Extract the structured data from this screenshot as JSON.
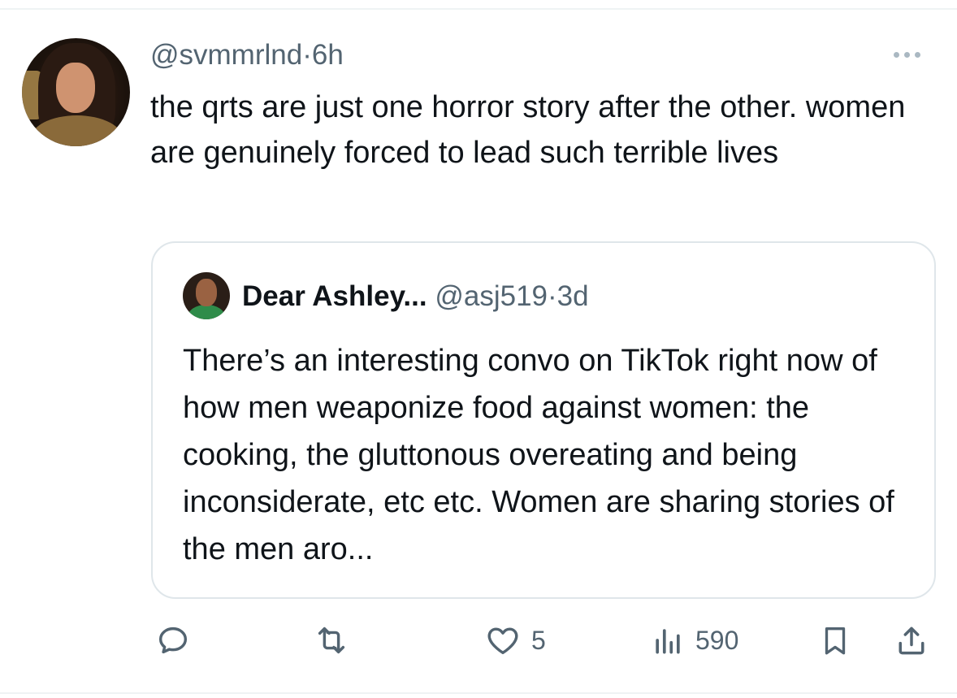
{
  "tweet": {
    "handle": "@svmmrlnd",
    "separator": "·",
    "time": "6h",
    "text": "the qrts are just one horror story after the other. women are genuinely forced to lead such terrible lives"
  },
  "quoted_tweet": {
    "display_name": "Dear Ashley...",
    "handle": "@asj519",
    "separator": "·",
    "time": "3d",
    "text": "There’s an interesting convo on TikTok right now of how men weaponize food against women: the cooking, the gluttonous overeating and being inconsiderate, etc etc. Women are sharing stories of the men aro..."
  },
  "actions": {
    "reply_count": "",
    "retweet_count": "",
    "like_count": "5",
    "views_count": "590"
  },
  "icons": {
    "more": "more-horizontal-icon",
    "reply": "reply-icon",
    "retweet": "retweet-icon",
    "like": "heart-icon",
    "views": "views-chart-icon",
    "bookmark": "bookmark-icon",
    "share": "share-icon"
  },
  "colors": {
    "text": "#0f1419",
    "secondary": "#536471",
    "border": "#dfe6ea"
  }
}
